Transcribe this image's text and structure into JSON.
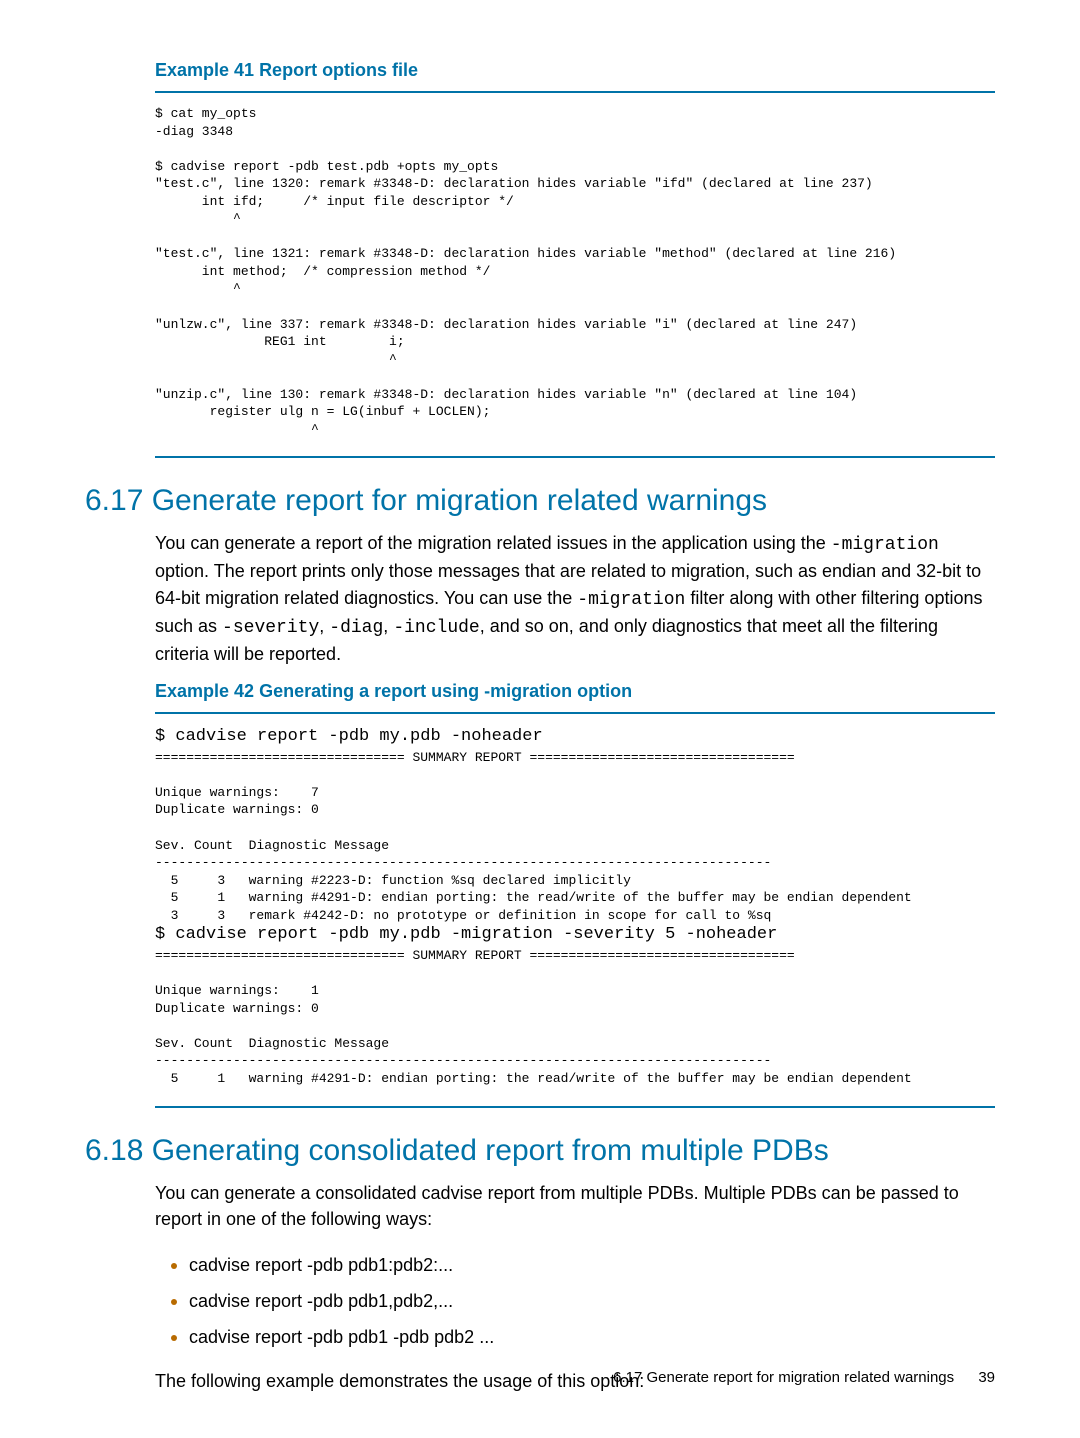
{
  "example41": {
    "title": "Example 41 Report options file",
    "code": "$ cat my_opts\n-diag 3348\n\n$ cadvise report -pdb test.pdb +opts my_opts\n\"test.c\", line 1320: remark #3348-D: declaration hides variable \"ifd\" (declared at line 237)\n      int ifd;     /* input file descriptor */\n          ^\n\n\"test.c\", line 1321: remark #3348-D: declaration hides variable \"method\" (declared at line 216)\n      int method;  /* compression method */\n          ^\n\n\"unlzw.c\", line 337: remark #3348-D: declaration hides variable \"i\" (declared at line 247)\n              REG1 int        i;\n                              ^\n\n\"unzip.c\", line 130: remark #3348-D: declaration hides variable \"n\" (declared at line 104)\n       register ulg n = LG(inbuf + LOCLEN);\n                    ^"
  },
  "section617": {
    "heading": "6.17 Generate report for migration related warnings",
    "para_pre": "You can generate a report of the migration related issues in the application using the ",
    "t_migration1": "-migration",
    "para_mid1": " option. The report prints only those messages that are related to migration, such as endian and 32-bit to 64-bit migration related diagnostics. You can use the ",
    "t_migration2": "-migration",
    "para_mid2": " filter along with other filtering options such as ",
    "t_severity": "-severity",
    "sep1": ", ",
    "t_diag": "-diag",
    "sep2": ", ",
    "t_include": "-include",
    "para_end": ", and so on, and only diagnostics that meet all the filtering criteria will be reported."
  },
  "example42": {
    "title": "Example 42 Generating a report using -migration option",
    "cmd1": "$ cadvise report -pdb my.pdb -noheader",
    "block1": "================================ SUMMARY REPORT ==================================\n\nUnique warnings:    7\nDuplicate warnings: 0\n\nSev. Count  Diagnostic Message\n-------------------------------------------------------------------------------\n  5     3   warning #2223-D: function %sq declared implicitly\n  5     1   warning #4291-D: endian porting: the read/write of the buffer may be endian dependent\n  3     3   remark #4242-D: no prototype or definition in scope for call to %sq",
    "cmd2": "$ cadvise report -pdb my.pdb -migration -severity 5 -noheader",
    "block2": "================================ SUMMARY REPORT ==================================\n\nUnique warnings:    1\nDuplicate warnings: 0\n\nSev. Count  Diagnostic Message\n-------------------------------------------------------------------------------\n  5     1   warning #4291-D: endian porting: the read/write of the buffer may be endian dependent"
  },
  "section618": {
    "heading": "6.18 Generating consolidated report from multiple PDBs",
    "para": "You can generate a consolidated cadvise report from multiple PDBs. Multiple PDBs can be passed to report in one of the following ways:",
    "bullets": [
      "cadvise report -pdb pdb1:pdb2:...",
      "cadvise report -pdb pdb1,pdb2,...",
      "cadvise report -pdb pdb1 -pdb pdb2 ..."
    ],
    "para2": "The following example demonstrates the usage of this option:"
  },
  "footer": {
    "text": "6.17 Generate report for migration related warnings",
    "page": "39"
  }
}
